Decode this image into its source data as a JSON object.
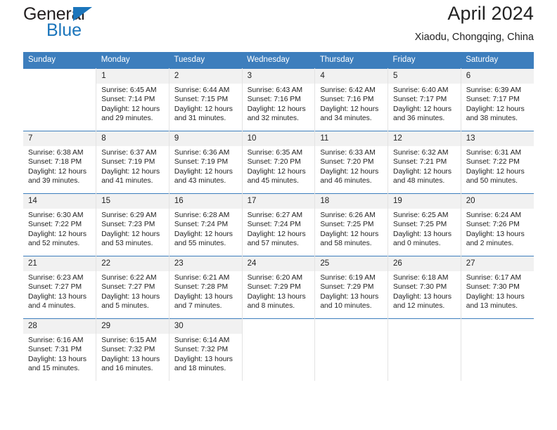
{
  "logo": {
    "primary_text": "General",
    "secondary_text": "Blue",
    "accent_color": "#1b75bb",
    "triangle_icon": "triangle-icon"
  },
  "header": {
    "title": "April 2024",
    "subtitle": "Xiaodu, Chongqing, China"
  },
  "theme": {
    "header_blue": "#3d7ebd",
    "daynum_bg": "#f1f1f1",
    "text": "#222222"
  },
  "calendar": {
    "weekday_headers": [
      "Sunday",
      "Monday",
      "Tuesday",
      "Wednesday",
      "Thursday",
      "Friday",
      "Saturday"
    ],
    "weeks": [
      [
        {
          "day": "",
          "lines": []
        },
        {
          "day": "1",
          "lines": [
            "Sunrise: 6:45 AM",
            "Sunset: 7:14 PM",
            "Daylight: 12 hours",
            "and 29 minutes."
          ]
        },
        {
          "day": "2",
          "lines": [
            "Sunrise: 6:44 AM",
            "Sunset: 7:15 PM",
            "Daylight: 12 hours",
            "and 31 minutes."
          ]
        },
        {
          "day": "3",
          "lines": [
            "Sunrise: 6:43 AM",
            "Sunset: 7:16 PM",
            "Daylight: 12 hours",
            "and 32 minutes."
          ]
        },
        {
          "day": "4",
          "lines": [
            "Sunrise: 6:42 AM",
            "Sunset: 7:16 PM",
            "Daylight: 12 hours",
            "and 34 minutes."
          ]
        },
        {
          "day": "5",
          "lines": [
            "Sunrise: 6:40 AM",
            "Sunset: 7:17 PM",
            "Daylight: 12 hours",
            "and 36 minutes."
          ]
        },
        {
          "day": "6",
          "lines": [
            "Sunrise: 6:39 AM",
            "Sunset: 7:17 PM",
            "Daylight: 12 hours",
            "and 38 minutes."
          ]
        }
      ],
      [
        {
          "day": "7",
          "lines": [
            "Sunrise: 6:38 AM",
            "Sunset: 7:18 PM",
            "Daylight: 12 hours",
            "and 39 minutes."
          ]
        },
        {
          "day": "8",
          "lines": [
            "Sunrise: 6:37 AM",
            "Sunset: 7:19 PM",
            "Daylight: 12 hours",
            "and 41 minutes."
          ]
        },
        {
          "day": "9",
          "lines": [
            "Sunrise: 6:36 AM",
            "Sunset: 7:19 PM",
            "Daylight: 12 hours",
            "and 43 minutes."
          ]
        },
        {
          "day": "10",
          "lines": [
            "Sunrise: 6:35 AM",
            "Sunset: 7:20 PM",
            "Daylight: 12 hours",
            "and 45 minutes."
          ]
        },
        {
          "day": "11",
          "lines": [
            "Sunrise: 6:33 AM",
            "Sunset: 7:20 PM",
            "Daylight: 12 hours",
            "and 46 minutes."
          ]
        },
        {
          "day": "12",
          "lines": [
            "Sunrise: 6:32 AM",
            "Sunset: 7:21 PM",
            "Daylight: 12 hours",
            "and 48 minutes."
          ]
        },
        {
          "day": "13",
          "lines": [
            "Sunrise: 6:31 AM",
            "Sunset: 7:22 PM",
            "Daylight: 12 hours",
            "and 50 minutes."
          ]
        }
      ],
      [
        {
          "day": "14",
          "lines": [
            "Sunrise: 6:30 AM",
            "Sunset: 7:22 PM",
            "Daylight: 12 hours",
            "and 52 minutes."
          ]
        },
        {
          "day": "15",
          "lines": [
            "Sunrise: 6:29 AM",
            "Sunset: 7:23 PM",
            "Daylight: 12 hours",
            "and 53 minutes."
          ]
        },
        {
          "day": "16",
          "lines": [
            "Sunrise: 6:28 AM",
            "Sunset: 7:24 PM",
            "Daylight: 12 hours",
            "and 55 minutes."
          ]
        },
        {
          "day": "17",
          "lines": [
            "Sunrise: 6:27 AM",
            "Sunset: 7:24 PM",
            "Daylight: 12 hours",
            "and 57 minutes."
          ]
        },
        {
          "day": "18",
          "lines": [
            "Sunrise: 6:26 AM",
            "Sunset: 7:25 PM",
            "Daylight: 12 hours",
            "and 58 minutes."
          ]
        },
        {
          "day": "19",
          "lines": [
            "Sunrise: 6:25 AM",
            "Sunset: 7:25 PM",
            "Daylight: 13 hours",
            "and 0 minutes."
          ]
        },
        {
          "day": "20",
          "lines": [
            "Sunrise: 6:24 AM",
            "Sunset: 7:26 PM",
            "Daylight: 13 hours",
            "and 2 minutes."
          ]
        }
      ],
      [
        {
          "day": "21",
          "lines": [
            "Sunrise: 6:23 AM",
            "Sunset: 7:27 PM",
            "Daylight: 13 hours",
            "and 4 minutes."
          ]
        },
        {
          "day": "22",
          "lines": [
            "Sunrise: 6:22 AM",
            "Sunset: 7:27 PM",
            "Daylight: 13 hours",
            "and 5 minutes."
          ]
        },
        {
          "day": "23",
          "lines": [
            "Sunrise: 6:21 AM",
            "Sunset: 7:28 PM",
            "Daylight: 13 hours",
            "and 7 minutes."
          ]
        },
        {
          "day": "24",
          "lines": [
            "Sunrise: 6:20 AM",
            "Sunset: 7:29 PM",
            "Daylight: 13 hours",
            "and 8 minutes."
          ]
        },
        {
          "day": "25",
          "lines": [
            "Sunrise: 6:19 AM",
            "Sunset: 7:29 PM",
            "Daylight: 13 hours",
            "and 10 minutes."
          ]
        },
        {
          "day": "26",
          "lines": [
            "Sunrise: 6:18 AM",
            "Sunset: 7:30 PM",
            "Daylight: 13 hours",
            "and 12 minutes."
          ]
        },
        {
          "day": "27",
          "lines": [
            "Sunrise: 6:17 AM",
            "Sunset: 7:30 PM",
            "Daylight: 13 hours",
            "and 13 minutes."
          ]
        }
      ],
      [
        {
          "day": "28",
          "lines": [
            "Sunrise: 6:16 AM",
            "Sunset: 7:31 PM",
            "Daylight: 13 hours",
            "and 15 minutes."
          ]
        },
        {
          "day": "29",
          "lines": [
            "Sunrise: 6:15 AM",
            "Sunset: 7:32 PM",
            "Daylight: 13 hours",
            "and 16 minutes."
          ]
        },
        {
          "day": "30",
          "lines": [
            "Sunrise: 6:14 AM",
            "Sunset: 7:32 PM",
            "Daylight: 13 hours",
            "and 18 minutes."
          ]
        },
        {
          "day": "",
          "lines": []
        },
        {
          "day": "",
          "lines": []
        },
        {
          "day": "",
          "lines": []
        },
        {
          "day": "",
          "lines": []
        }
      ]
    ]
  }
}
